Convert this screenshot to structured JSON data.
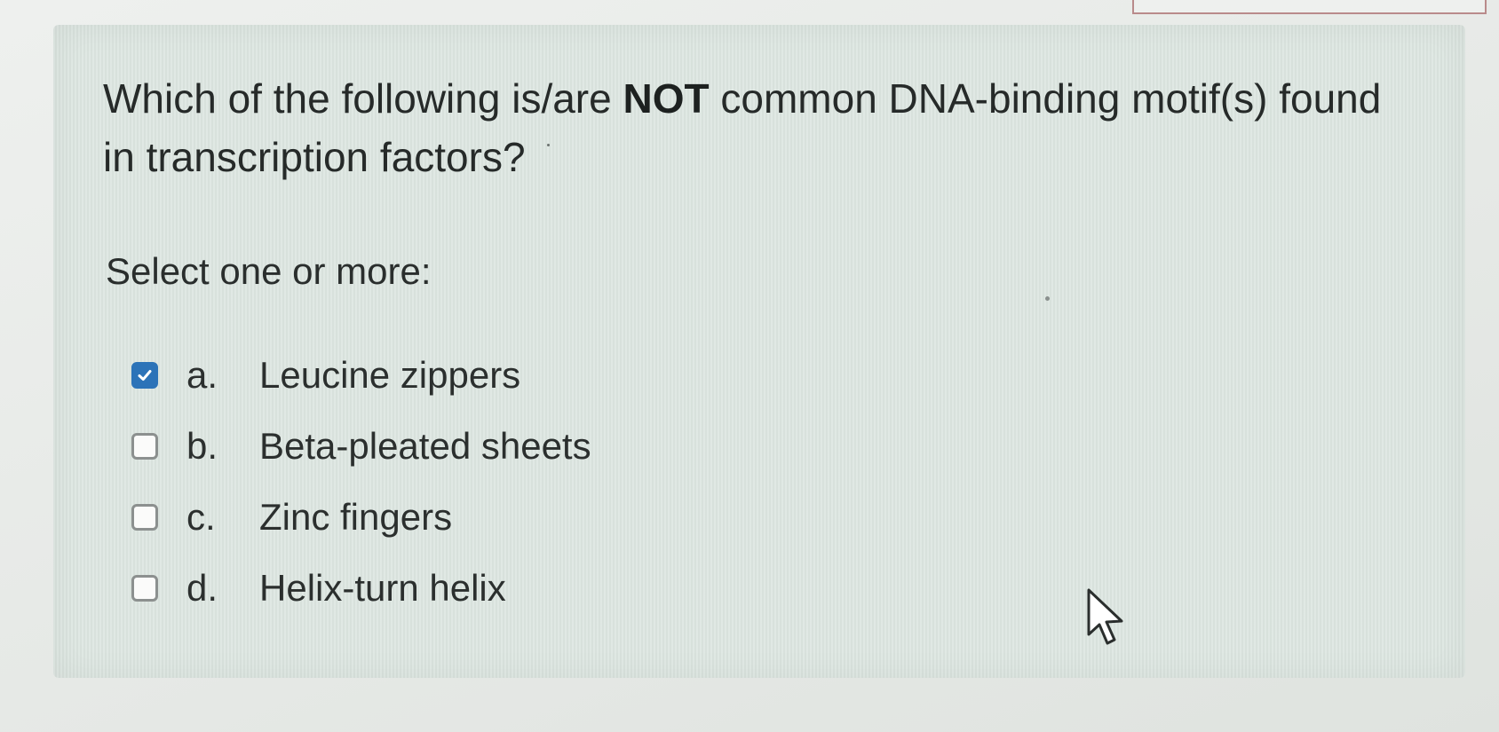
{
  "question": {
    "text_before": "Which of the following is/are ",
    "emphasis": "NOT",
    "text_after": " common DNA-binding motif(s) found in transcription factors?",
    "prompt": "Select one or more:"
  },
  "options": [
    {
      "letter": "a.",
      "label": "Leucine zippers",
      "checked": true
    },
    {
      "letter": "b.",
      "label": "Beta-pleated sheets",
      "checked": false
    },
    {
      "letter": "c.",
      "label": "Zinc fingers",
      "checked": false
    },
    {
      "letter": "d.",
      "label": "Helix-turn helix",
      "checked": false
    }
  ],
  "colors": {
    "checkbox_checked": "#2c73b8",
    "panel_background": "#dde6e1"
  },
  "icons": {
    "check": "check-icon",
    "cursor": "mouse-pointer-icon"
  }
}
